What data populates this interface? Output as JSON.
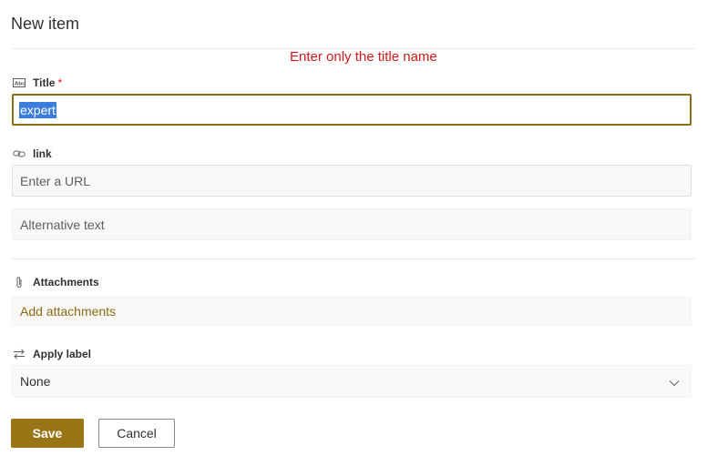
{
  "panel": {
    "title": "New item"
  },
  "note": "Enter only the title name",
  "fields": {
    "title": {
      "label": "Title",
      "required_mark": "*",
      "value": "expert",
      "icon": "text-field-icon"
    },
    "link": {
      "label": "link",
      "url_placeholder": "Enter a URL",
      "alt_placeholder": "Alternative text",
      "icon": "link-icon"
    },
    "attachments": {
      "label": "Attachments",
      "action": "Add attachments",
      "icon": "paperclip-icon"
    },
    "apply_label": {
      "label": "Apply label",
      "selected": "None",
      "icon": "swap-arrows-icon"
    }
  },
  "buttons": {
    "save": "Save",
    "cancel": "Cancel"
  },
  "colors": {
    "accent": "#9a7515",
    "note": "#d0171c",
    "selection": "#3b7ddd"
  }
}
